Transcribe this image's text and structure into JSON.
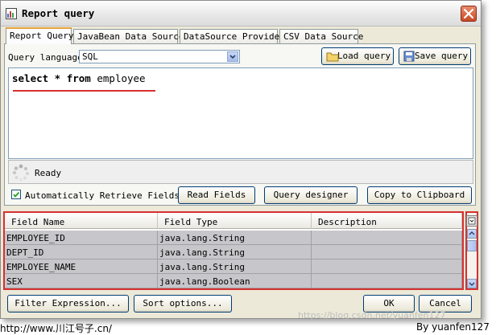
{
  "window": {
    "title": "Report query"
  },
  "tabs": [
    {
      "label": "Report Query",
      "active": true
    },
    {
      "label": "JavaBean Data Source",
      "active": false
    },
    {
      "label": "DataSource Provider",
      "active": false
    },
    {
      "label": "CSV Data Source",
      "active": false
    }
  ],
  "query": {
    "language_label": "Query language",
    "language_value": "SQL",
    "load_button": "Load query",
    "save_button": "Save query",
    "sql_keywords": "select * from",
    "sql_table": "employee",
    "status": "Ready"
  },
  "options": {
    "auto_retrieve_label": "Automatically Retrieve Fields",
    "auto_retrieve_checked": true,
    "read_fields_button": "Read Fields",
    "query_designer_button": "Query designer",
    "copy_clipboard_button": "Copy to Clipboard"
  },
  "fields_table": {
    "columns": [
      "Field Name",
      "Field Type",
      "Description"
    ],
    "rows": [
      {
        "name": "EMPLOYEE_ID",
        "type": "java.lang.String",
        "description": ""
      },
      {
        "name": "DEPT_ID",
        "type": "java.lang.String",
        "description": ""
      },
      {
        "name": "EMPLOYEE_NAME",
        "type": "java.lang.String",
        "description": ""
      },
      {
        "name": "SEX",
        "type": "java.lang.Boolean",
        "description": ""
      }
    ]
  },
  "footer": {
    "filter_button": "Filter Expression...",
    "sort_button": "Sort options...",
    "ok_button": "OK",
    "cancel_button": "Cancel"
  },
  "page_footer": {
    "left_text": "http://www.川江号子.cn/",
    "right_text": "By yuanfen127",
    "watermark": "https://blog.csdn.net/yuanfen127"
  },
  "colors": {
    "highlight_border": "#d63030",
    "selected_row": "#c7c7cb",
    "tab_accent": "#e6a23c"
  },
  "icons": [
    "app-icon",
    "close-icon",
    "chevron-down-icon",
    "load-icon",
    "save-icon",
    "spinner-icon",
    "checkbox-icon",
    "column-menu-icon"
  ]
}
